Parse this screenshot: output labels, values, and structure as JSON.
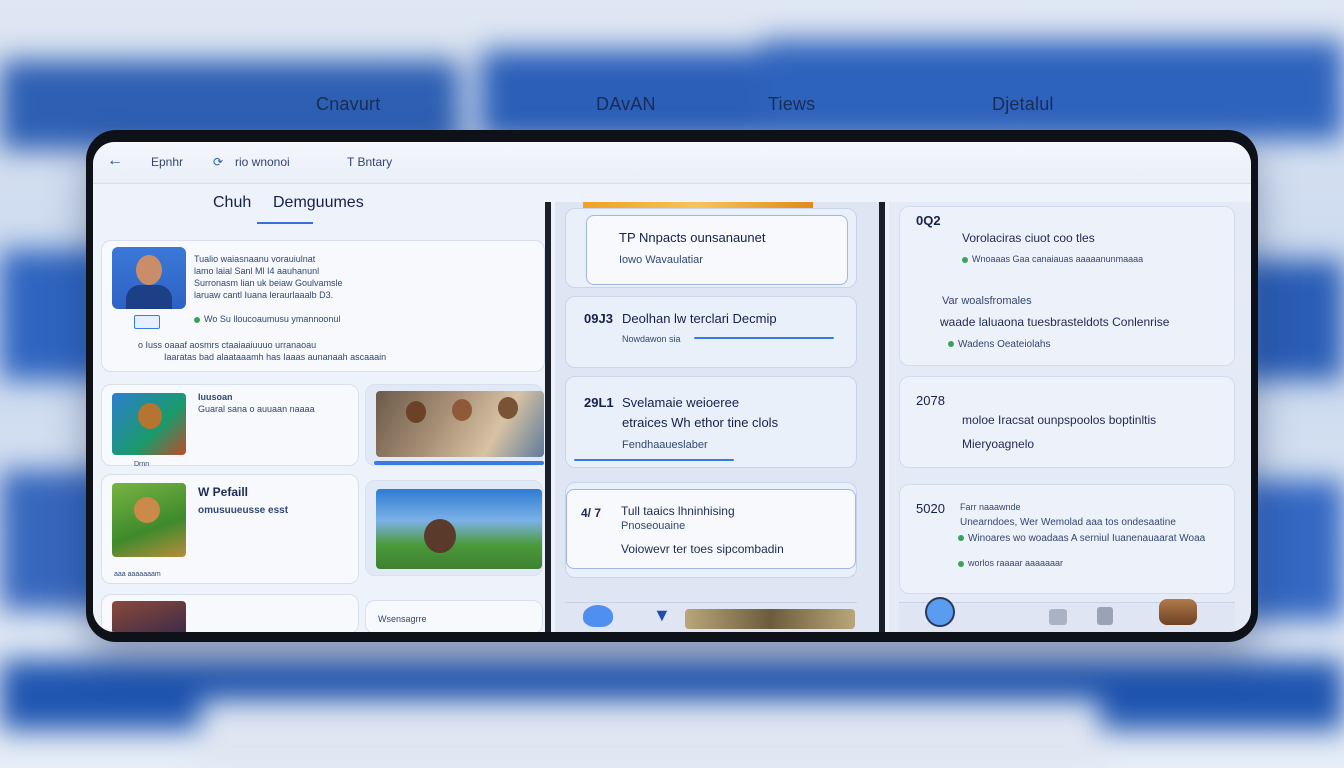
{
  "top_tabs": [
    "Cnavurt",
    "DAvAN",
    "Tiews",
    "Djetalul"
  ],
  "app_bar": {
    "back_icon": "arrow-left-icon",
    "item1": "Epnhr",
    "item2": "rio wnonoi",
    "item3": "T Bntary"
  },
  "left": {
    "title_a": "Chuh",
    "title_b": "Demguumes",
    "profile": {
      "line1": "Tualio waiasnaanu vorauiulnat",
      "line2": "lamo laial Sanl Ml I4 aauhanunl",
      "line3": "Surronasm lian uk beiaw Goulvamsle",
      "line4": "laruaw cantl Iuana leraurlaaalb D3.",
      "line5": "Wo Su lloucoaumusu ymannoonul",
      "line6": "o Iuss oaaaf aosmrs ctaaiaaiuuuo urranaoau",
      "line7": "Iaaratas bad alaataaamh has Iaaas aunanaah ascaaain"
    },
    "list": [
      {
        "title": "Iuusoan",
        "sub": "Guaral sana o auuaan naaaa",
        "caption": "Drnn"
      },
      {
        "title": "W Pefaill",
        "sub": "omusuueusse esst",
        "caption": "aaa aaaaaaam"
      },
      {
        "title": "",
        "sub": "",
        "caption": ""
      }
    ],
    "photo_caption": "Wsensagrre"
  },
  "mid": {
    "cards": [
      {
        "year": "",
        "title": "TP Nnpacts ounsanaunet",
        "sub": "Iowo Wavaulatiar"
      },
      {
        "year": "09J3",
        "title": "Deolhan lw terclari Decmip",
        "sub": "Nowdawon sia"
      },
      {
        "year": "29L1",
        "title": "Svelamaie weioeree",
        "sub": "etraices Wh ethor tine clols",
        "sub2": "Fendhaaueslaber"
      },
      {
        "year": "4/ 7",
        "title": "Tull taaics lhninhising",
        "sub": "Pnoseouaine",
        "sub2": "Voiowevr ter toes sipcombadin"
      }
    ]
  },
  "right": {
    "cards": [
      {
        "year": "0Q2",
        "title": "Vorolaciras ciuot coo tles",
        "sub": "Wnoaaas Gaa canaiauas aaaaanunmaaaa",
        "title2": "Var woalsfromales",
        "sub2": "waade laluaona tuesbrasteldots Conlenrise",
        "sub3": "Wadens Oeateiolahs"
      },
      {
        "year": "2078",
        "title": "moloe Iracsat ounpspoolos boptinltis",
        "sub": "Mieryoagnelo"
      },
      {
        "year": "5020",
        "title": "Farr naaawnde",
        "sub": "Unearndoes, Wer Wemolad aaa tos ondesaatine",
        "sub2": "Winoares wo woadaas A serniul Iuanenauaarat Woaa",
        "sub3": "worlos raaaar aaaaaaar"
      }
    ]
  },
  "icons": {
    "shield": "shield-icon",
    "pin": "location-pin-icon",
    "bag": "bag-icon"
  }
}
